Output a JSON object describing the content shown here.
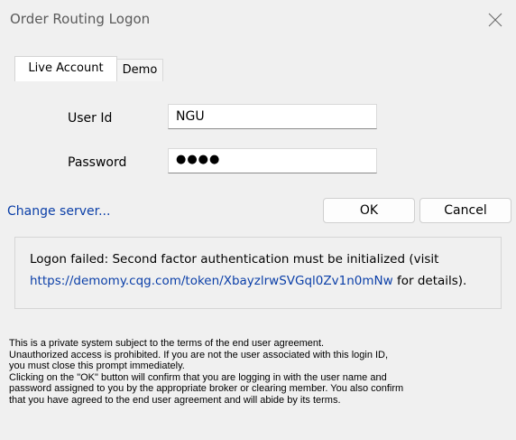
{
  "window": {
    "title": "Order Routing Logon"
  },
  "tabs": [
    {
      "label": "Live Account",
      "active": true
    },
    {
      "label": "Demo",
      "active": false
    }
  ],
  "form": {
    "user_id": {
      "label": "User Id",
      "value": "NGU"
    },
    "password": {
      "label": "Password",
      "masked_value": "●●●●"
    }
  },
  "links": {
    "change_server": "Change server..."
  },
  "buttons": {
    "ok": "OK",
    "cancel": "Cancel"
  },
  "message": {
    "line1": "Logon failed: Second factor authentication must be initialized (visit",
    "url": "https://demomy.cqg.com/token/XbayzlrwSVGql0Zv1n0mNw",
    "line2_suffix": " for details)."
  },
  "disclaimer": [
    "This is a private system subject to the terms of the end user agreement.",
    "Unauthorized access is prohibited. If you are not the user associated with this login ID,",
    "you must close this prompt immediately.",
    "Clicking on the \"OK\" button will confirm that you are logging in with the user name and",
    "password assigned to you by the appropriate broker or clearing member. You also confirm",
    "that you have agreed to the end user agreement and will abide by its terms."
  ],
  "colors": {
    "background": "#f0f0f0",
    "link": "#0b3fa8",
    "title_text": "#5a5a5a"
  },
  "icons": {
    "close": "close-icon"
  }
}
